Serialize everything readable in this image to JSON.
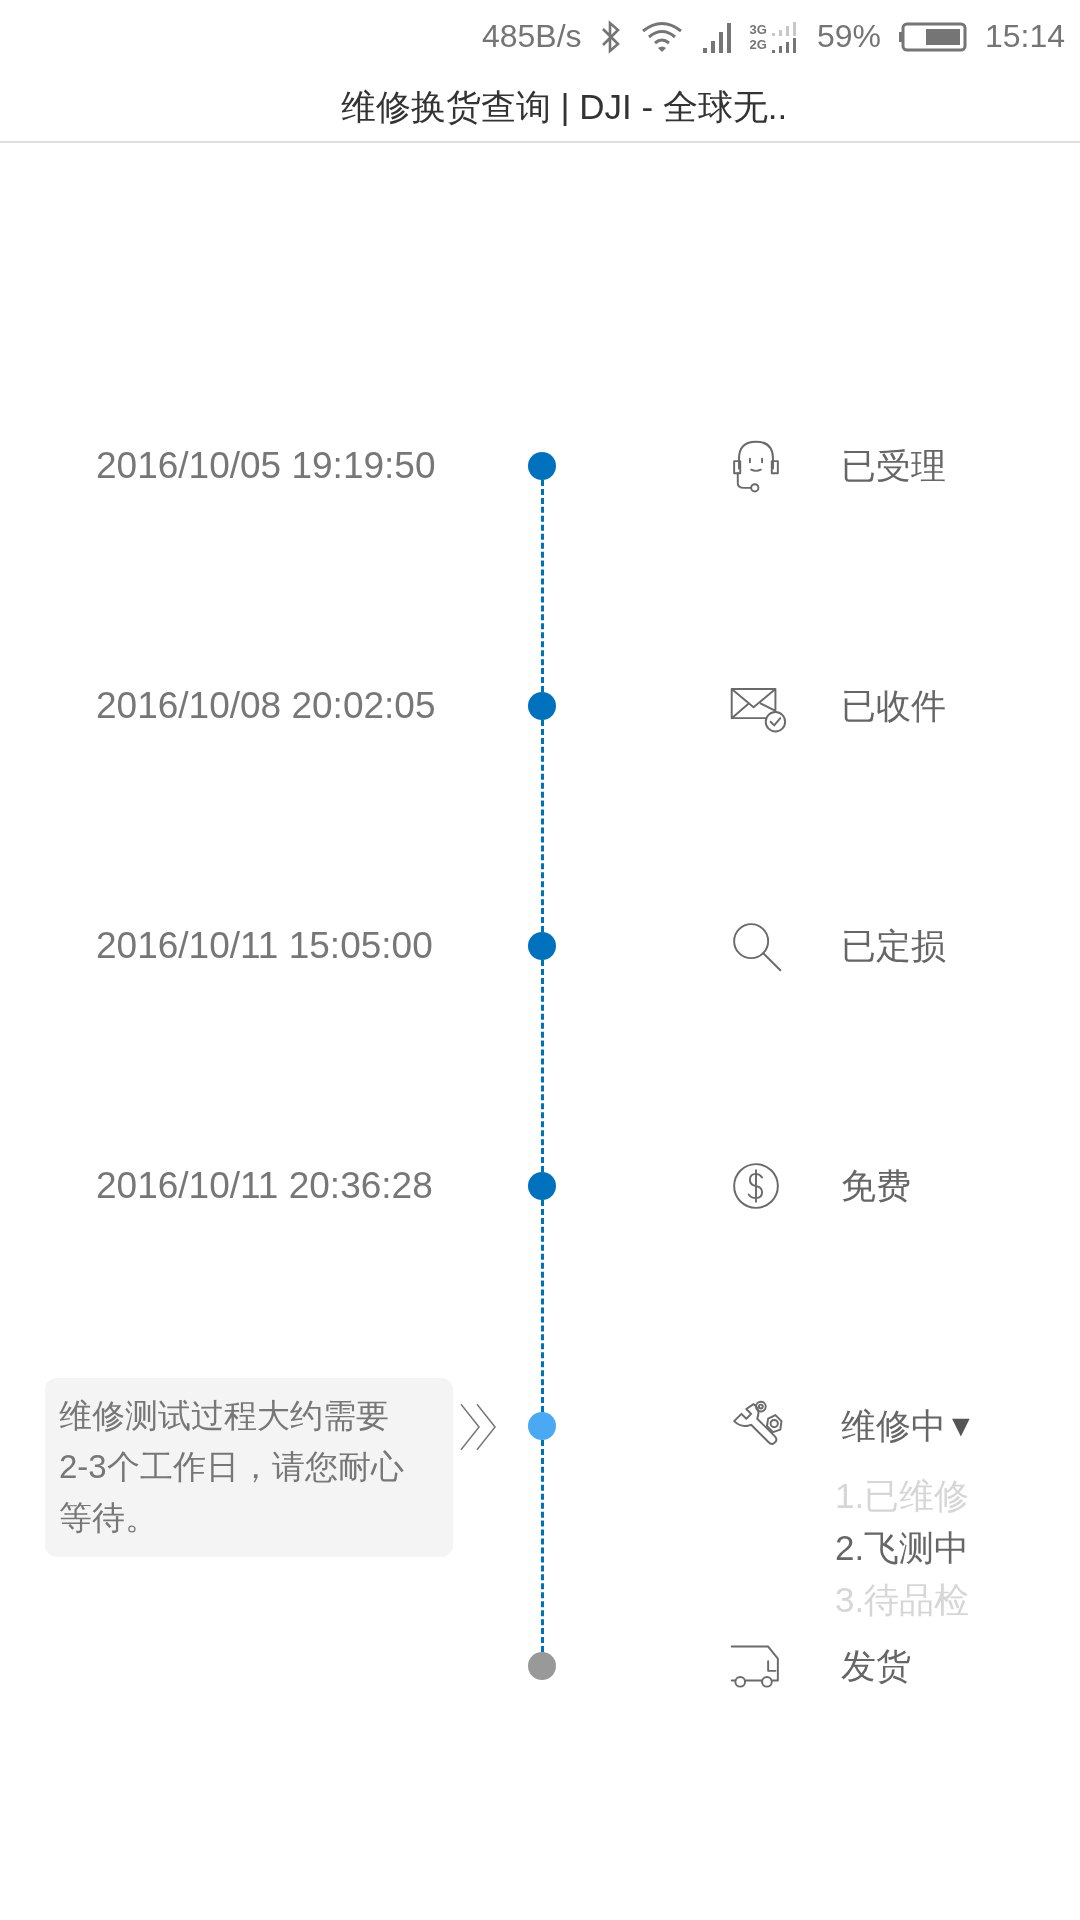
{
  "status_bar": {
    "speed": "485B/s",
    "network_top": "3G",
    "network_bottom": "2G",
    "battery": "59%",
    "time": "15:14"
  },
  "title": "维修换货查询 | DJI - 全球无..",
  "steps": [
    {
      "kind": "headset",
      "time": "2016/10/05 19:19:50",
      "label": "已受理",
      "completed": true,
      "selected": false
    },
    {
      "kind": "envelope",
      "time": "2016/10/08 20:02:05",
      "label": "已收件",
      "completed": true,
      "selected": false
    },
    {
      "kind": "magnifier",
      "time": "2016/10/11 15:05:00",
      "label": "已定损",
      "completed": true,
      "selected": false
    },
    {
      "kind": "coin",
      "time": "2016/10/11 20:36:28",
      "label": "免费",
      "completed": true,
      "selected": false
    },
    {
      "kind": "tools",
      "note": [
        "维修测试过程大约需要",
        "2-3个工作日，请您耐心",
        "等待。"
      ],
      "label": "维修中",
      "caret": "▼",
      "expanded": true,
      "selected": true,
      "substeps": [
        {
          "label": "1.已维修",
          "selected": false
        },
        {
          "label": "2.飞测中",
          "selected": true
        },
        {
          "label": "3.待品检",
          "selected": false
        }
      ]
    },
    {
      "kind": "truck",
      "label": "发货",
      "completed": false,
      "selected": false
    }
  ]
}
